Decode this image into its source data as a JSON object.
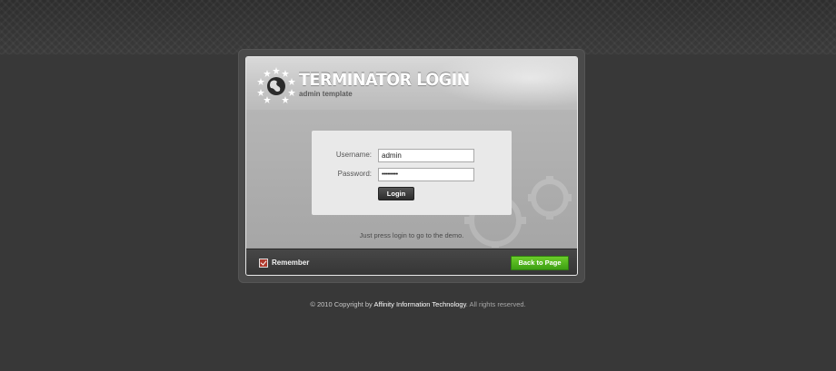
{
  "header": {
    "title": "TERMINATOR LOGIN",
    "subtitle": "admin template"
  },
  "form": {
    "username_label": "Username:",
    "username_value": "admin",
    "password_label": "Password:",
    "password_value": "•••••••••",
    "login_button": "Login",
    "hint": "Just press login to go to the demo."
  },
  "footer_bar": {
    "remember_label": "Remember",
    "remember_checked": true,
    "back_button": "Back to Page"
  },
  "copyright": {
    "prefix": "© 2010 Copyright by ",
    "company": "Affinity Information Technology",
    "suffix": ". All rights reserved."
  },
  "colors": {
    "background": "#383838",
    "accent_green": "#4db31a",
    "checkbox_red": "#b03a2e"
  },
  "icons": {
    "logo": "globe-stars-icon",
    "background_decoration": "gears-icon",
    "checkbox": "checkbox-checked-icon"
  }
}
